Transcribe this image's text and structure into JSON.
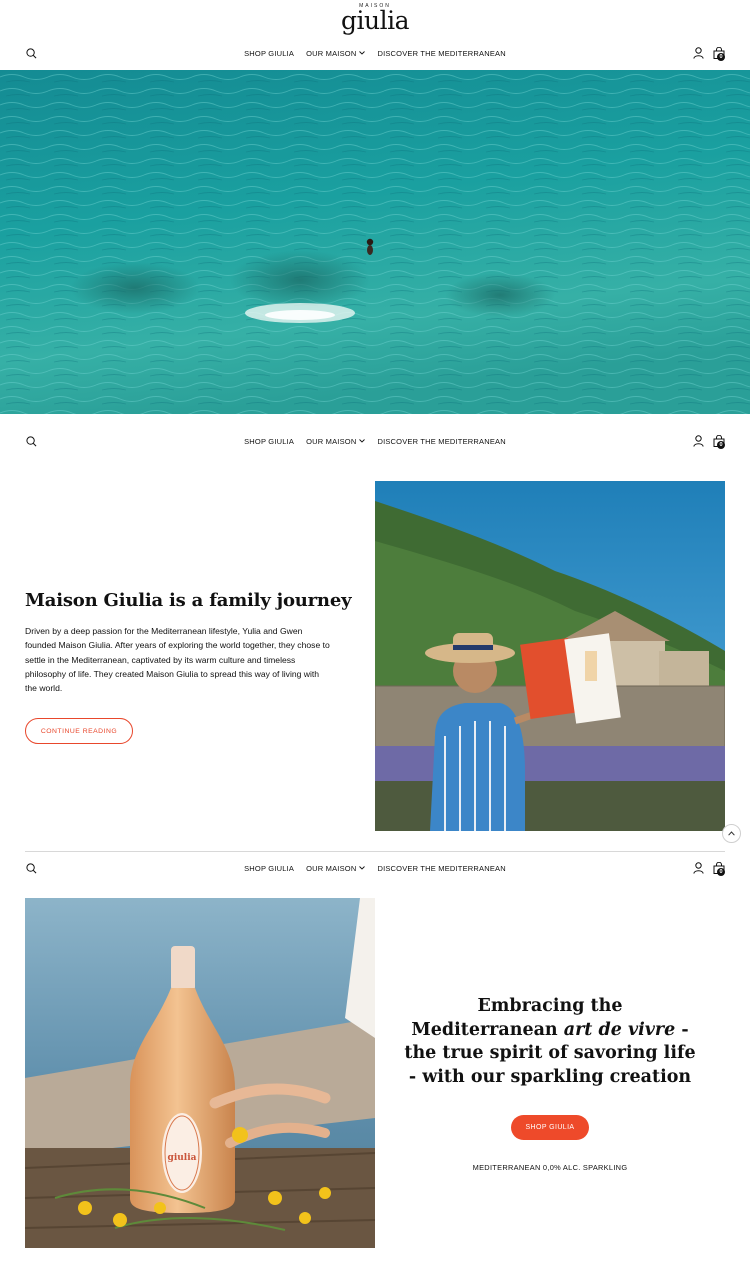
{
  "logo": {
    "small": "MAISON",
    "main": "giulia"
  },
  "nav": {
    "items": [
      {
        "label": "SHOP GIULIA"
      },
      {
        "label": "OUR MAISON",
        "has_dropdown": true
      },
      {
        "label": "DISCOVER THE MEDITERRANEAN"
      }
    ],
    "cart_count": "0",
    "icons": {
      "search": "search-icon",
      "account": "user-icon",
      "cart": "bag-icon",
      "chevron": "chevron-down-icon"
    }
  },
  "hero": {
    "alt": "swimmer in turquoise mediterranean sea"
  },
  "journey": {
    "title": "Maison Giulia is a family journey",
    "text": "Driven by a deep passion for the Mediterranean lifestyle, Yulia and Gwen founded Maison Giulia. After years of exploring the world together, they chose to settle in the Mediterranean, captivated by its warm culture and timeless philosophy of life. They created Maison Giulia to spread this way of living with the world.",
    "button": "CONTINUE READING"
  },
  "embrace": {
    "line1": "Embracing the",
    "line2_pre": "Mediterranean ",
    "line2_em": "art de vivre",
    "line2_post": " -",
    "line3": "the true spirit of savoring life",
    "line4": "- with our sparkling creation",
    "button": "SHOP GIULIA",
    "tagline": "MEDITERRANEAN 0,0% ALC. SPARKLING"
  },
  "bottle_label": {
    "brand": "giulia"
  },
  "colors": {
    "accent": "#ee4a2a",
    "accent_outline": "#e8472c",
    "text": "#111111",
    "sea": "#1f9a9c"
  }
}
